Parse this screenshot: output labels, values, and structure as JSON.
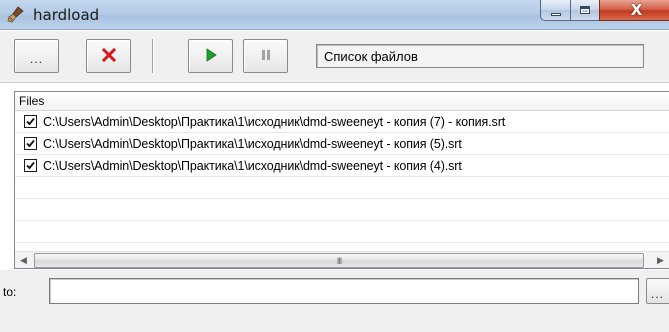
{
  "window": {
    "title": "hardload",
    "app_icon": "broom-icon",
    "caption": {
      "minimize_icon": "minimize-icon",
      "maximize_icon": "maximize-icon",
      "close_icon": "close-icon",
      "close_glyph": "X"
    }
  },
  "toolbar": {
    "browse_label": "...",
    "delete_icon": "red-x-icon",
    "start_icon": "play-icon",
    "pause_icon": "pause-icon",
    "status_text": "Список файлов"
  },
  "file_list": {
    "header": "Files",
    "rows": [
      {
        "checked": true,
        "path": "C:\\Users\\Admin\\Desktop\\Практика\\1\\исходник\\dmd-sweeneyt - копия (7) - копия.srt"
      },
      {
        "checked": true,
        "path": "C:\\Users\\Admin\\Desktop\\Практика\\1\\исходник\\dmd-sweeneyt - копия (5).srt"
      },
      {
        "checked": true,
        "path": "C:\\Users\\Admin\\Desktop\\Практика\\1\\исходник\\dmd-sweeneyt - копия (4).srt"
      }
    ],
    "scrollbar": {
      "left_arrow": "◀",
      "right_arrow": "▶",
      "grip": "III"
    }
  },
  "destination": {
    "label": "to:",
    "value": "",
    "placeholder": "",
    "browse_label": "..."
  },
  "colors": {
    "delete_red": "#d8171b",
    "play_green": "#1fa02a",
    "pause_gray": "#a2a2a2",
    "checkmark": "#111111"
  }
}
